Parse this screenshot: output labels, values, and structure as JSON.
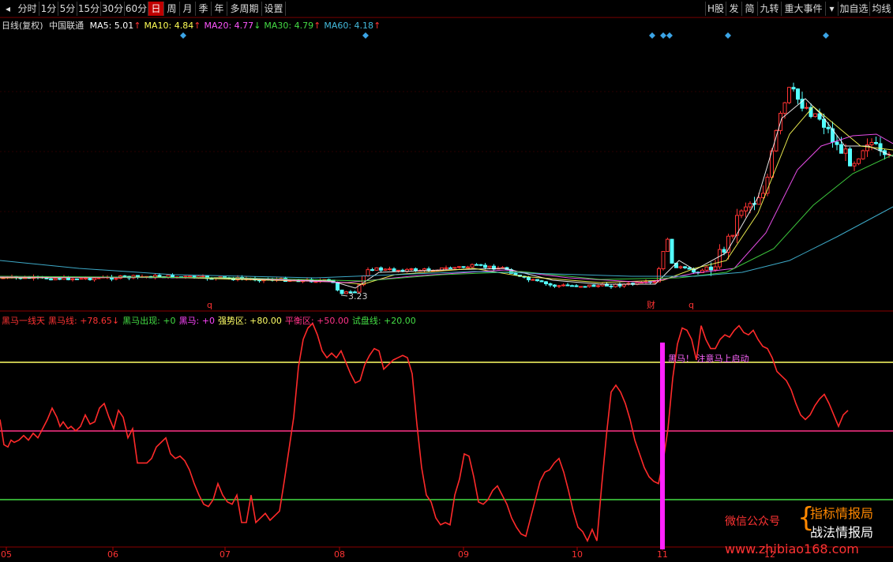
{
  "toolbar": {
    "arrow": "◂",
    "periods": [
      "分时",
      "1分",
      "5分",
      "15分",
      "30分",
      "60分",
      "日",
      "周",
      "月",
      "季",
      "年",
      "多周期",
      "设置"
    ],
    "active_index": 6,
    "right_buttons": [
      "H股",
      "发",
      "简",
      "九转",
      "重大事件",
      "▾",
      "加自选",
      "均线"
    ]
  },
  "main_legend": {
    "chart_type": "日线(复权)",
    "stock": "中国联通",
    "items": [
      {
        "label": "MA5:",
        "value": "5.01",
        "arrow": "↑",
        "color": "#ffffff"
      },
      {
        "label": "MA10:",
        "value": "4.84",
        "arrow": "↑",
        "color": "#ffff55"
      },
      {
        "label": "MA20:",
        "value": "4.77",
        "arrow": "↓",
        "color": "#ff55ff"
      },
      {
        "label": "MA30:",
        "value": "4.79",
        "arrow": "↑",
        "color": "#44dd44"
      },
      {
        "label": "MA60:",
        "value": "4.18",
        "arrow": "↑",
        "color": "#44bbdd"
      }
    ]
  },
  "indicator_legend": {
    "items": [
      {
        "text": "黑马一线天",
        "color": "#ff3333"
      },
      {
        "text": "黑马线: +78.65↓",
        "color": "#ff3333"
      },
      {
        "text": "黑马出现: +0",
        "color": "#44dd44"
      },
      {
        "text": "黑马: +0",
        "color": "#ff44ff"
      },
      {
        "text": "强势区: +80.00",
        "color": "#ffff66"
      },
      {
        "text": "平衡区: +50.00",
        "color": "#ff3388"
      },
      {
        "text": "试盘线: +20.00",
        "color": "#44dd44"
      }
    ]
  },
  "chart_data": {
    "type": "line",
    "x_ticks": [
      "05",
      "06",
      "07",
      "08",
      "09",
      "10",
      "11",
      "12"
    ],
    "price_annotation": "3.23",
    "markers": [
      "q",
      "财",
      "q"
    ],
    "ma_lines": [
      {
        "name": "MA5",
        "color": "#ffffff"
      },
      {
        "name": "MA10",
        "color": "#ffff55"
      },
      {
        "name": "MA20",
        "color": "#ff55ff"
      },
      {
        "name": "MA30",
        "color": "#44dd44"
      },
      {
        "name": "MA60",
        "color": "#44bbdd"
      }
    ],
    "indicator": {
      "levels": [
        {
          "name": "强势区",
          "value": 80,
          "color": "#ffff66"
        },
        {
          "name": "平衡区",
          "value": 50,
          "color": "#ff3388"
        },
        {
          "name": "试盘线",
          "value": 20,
          "color": "#44dd44"
        }
      ],
      "signal_text": "黑马！ 注意马上启动",
      "x": [
        0,
        5,
        10,
        14,
        18,
        24,
        30,
        36,
        42,
        48,
        54,
        60,
        66,
        72,
        76,
        80,
        86,
        90,
        96,
        102,
        108,
        114,
        120,
        126,
        132,
        138,
        144,
        150,
        156,
        162,
        168,
        174,
        180,
        186,
        192,
        198,
        204,
        210,
        216,
        222,
        228,
        234,
        240,
        246,
        252,
        258,
        264,
        270,
        276,
        282,
        288,
        294,
        300,
        306,
        312,
        318,
        324,
        330,
        336,
        342,
        348,
        354,
        360,
        366,
        372,
        378,
        384,
        390,
        396,
        402,
        408,
        414,
        420,
        426,
        432,
        438,
        444,
        450,
        456,
        462,
        468,
        474,
        480,
        486,
        492,
        498,
        504,
        510,
        516,
        522,
        528,
        534,
        540,
        546,
        552,
        558,
        564,
        570,
        576,
        582,
        588,
        594,
        600,
        606,
        612,
        618,
        624,
        630,
        636,
        642,
        648,
        654,
        660,
        666,
        672,
        678,
        684,
        690,
        696,
        702,
        708,
        714,
        720,
        726,
        732,
        738,
        744,
        750,
        756,
        762,
        768,
        774,
        780,
        786,
        792,
        798,
        804,
        810,
        816,
        822,
        828,
        834,
        840,
        846,
        852,
        858,
        864,
        870,
        876,
        882,
        888,
        894,
        900,
        906,
        912,
        918,
        924,
        930,
        936,
        942,
        948,
        954,
        960,
        966,
        972,
        978,
        984,
        990,
        996,
        1002,
        1008,
        1014,
        1020,
        1026,
        1032,
        1038,
        1044,
        1050,
        1056,
        1062,
        1068,
        1074,
        1080,
        1086,
        1092,
        1098,
        1104,
        1110,
        1116,
        1122,
        1131
      ],
      "y": [
        55,
        44,
        43,
        46,
        45,
        46,
        48,
        46,
        49,
        47,
        51,
        55,
        60,
        56,
        52,
        54,
        51,
        52,
        50,
        52,
        57,
        53,
        54,
        60,
        62,
        56,
        51,
        59,
        56,
        47,
        51,
        36,
        36,
        36,
        38,
        43,
        45,
        47,
        40,
        38,
        39,
        37,
        33,
        27,
        22,
        18,
        17,
        20,
        27,
        22,
        19,
        18,
        22,
        10,
        10,
        22,
        10,
        12,
        14,
        11,
        13,
        15,
        28,
        42,
        56,
        78,
        90,
        95,
        97,
        92,
        85,
        82,
        84,
        82,
        85,
        80,
        75,
        71,
        72,
        79,
        83,
        86,
        85,
        77,
        79,
        81,
        82,
        83,
        82,
        75,
        53,
        34,
        22,
        19,
        12,
        9,
        10,
        9,
        22,
        29,
        40,
        39,
        30,
        19,
        18,
        20,
        24,
        26,
        22,
        18,
        12,
        8,
        5,
        4,
        12,
        20,
        28,
        32,
        33,
        36,
        38,
        32,
        24,
        15,
        8,
        6,
        2,
        7,
        2,
        26,
        48,
        67,
        70,
        67,
        62,
        55,
        46,
        40,
        34,
        30,
        28,
        27,
        37,
        51,
        73,
        88,
        95,
        94,
        90,
        81,
        96,
        90,
        86,
        86,
        90,
        92,
        91,
        94,
        96,
        93,
        92,
        94,
        90,
        87,
        86,
        82,
        76,
        74,
        72,
        68,
        62,
        57,
        55,
        57,
        61,
        64,
        66,
        62,
        57,
        52,
        57,
        59
      ]
    }
  },
  "watermark": {
    "label": "微信公众号",
    "brand1": "指标情报局",
    "brand2": "战法情报局",
    "url": "www.zhibiao168.com"
  }
}
